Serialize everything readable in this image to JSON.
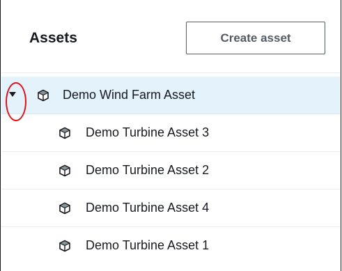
{
  "panel": {
    "title": "Assets",
    "create_button_label": "Create asset"
  },
  "tree": {
    "root": {
      "label": "Demo Wind Farm Asset",
      "expanded": true,
      "selected": true,
      "icon": "cube-icon",
      "toggle_icon": "caret-down-icon"
    },
    "children": [
      {
        "label": "Demo Turbine Asset 3",
        "icon": "cube-icon"
      },
      {
        "label": "Demo Turbine Asset 2",
        "icon": "cube-icon"
      },
      {
        "label": "Demo Turbine Asset 4",
        "icon": "cube-icon"
      },
      {
        "label": "Demo Turbine Asset 1",
        "icon": "cube-icon"
      }
    ]
  },
  "colors": {
    "selected_row": "#e3f2fb",
    "highlight_ring": "#e0101a",
    "cube_fill": "#ffffff",
    "cube_stroke": "#16191f",
    "cube_top": "#879596"
  }
}
